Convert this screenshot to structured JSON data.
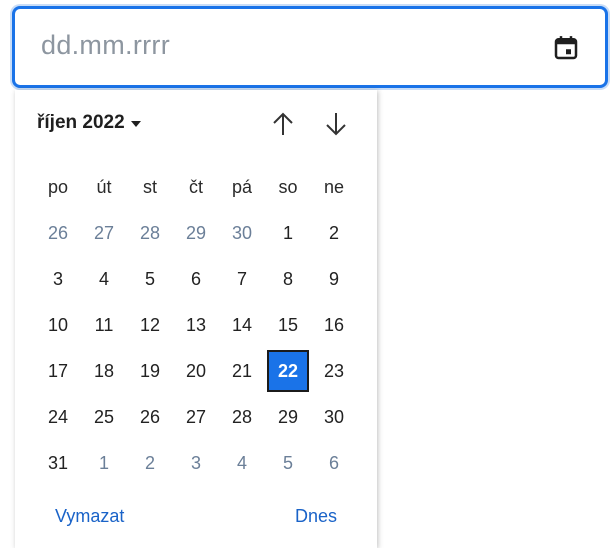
{
  "input": {
    "placeholder": "dd.mm.rrrr",
    "icon": "calendar-icon"
  },
  "calendar": {
    "month_label": "říjen 2022",
    "weekdays": [
      "po",
      "út",
      "st",
      "čt",
      "pá",
      "so",
      "ne"
    ],
    "weeks": [
      [
        {
          "d": "26",
          "o": true
        },
        {
          "d": "27",
          "o": true
        },
        {
          "d": "28",
          "o": true
        },
        {
          "d": "29",
          "o": true
        },
        {
          "d": "30",
          "o": true
        },
        {
          "d": "1",
          "o": false
        },
        {
          "d": "2",
          "o": false
        }
      ],
      [
        {
          "d": "3",
          "o": false
        },
        {
          "d": "4",
          "o": false
        },
        {
          "d": "5",
          "o": false
        },
        {
          "d": "6",
          "o": false
        },
        {
          "d": "7",
          "o": false
        },
        {
          "d": "8",
          "o": false
        },
        {
          "d": "9",
          "o": false
        }
      ],
      [
        {
          "d": "10",
          "o": false
        },
        {
          "d": "11",
          "o": false
        },
        {
          "d": "12",
          "o": false
        },
        {
          "d": "13",
          "o": false
        },
        {
          "d": "14",
          "o": false
        },
        {
          "d": "15",
          "o": false
        },
        {
          "d": "16",
          "o": false
        }
      ],
      [
        {
          "d": "17",
          "o": false
        },
        {
          "d": "18",
          "o": false
        },
        {
          "d": "19",
          "o": false
        },
        {
          "d": "20",
          "o": false
        },
        {
          "d": "21",
          "o": false
        },
        {
          "d": "22",
          "o": false,
          "selected": true
        },
        {
          "d": "23",
          "o": false
        }
      ],
      [
        {
          "d": "24",
          "o": false
        },
        {
          "d": "25",
          "o": false
        },
        {
          "d": "26",
          "o": false
        },
        {
          "d": "27",
          "o": false
        },
        {
          "d": "28",
          "o": false
        },
        {
          "d": "29",
          "o": false
        },
        {
          "d": "30",
          "o": false
        }
      ],
      [
        {
          "d": "31",
          "o": false
        },
        {
          "d": "1",
          "o": true
        },
        {
          "d": "2",
          "o": true
        },
        {
          "d": "3",
          "o": true
        },
        {
          "d": "4",
          "o": true
        },
        {
          "d": "5",
          "o": true
        },
        {
          "d": "6",
          "o": true
        }
      ]
    ],
    "clear_label": "Vymazat",
    "today_label": "Dnes",
    "nav_up_icon": "arrow-up-icon",
    "nav_down_icon": "arrow-down-icon"
  },
  "colors": {
    "accent": "#1a73e8",
    "other_month_text": "#6b7f98",
    "link": "#1a63c8"
  }
}
